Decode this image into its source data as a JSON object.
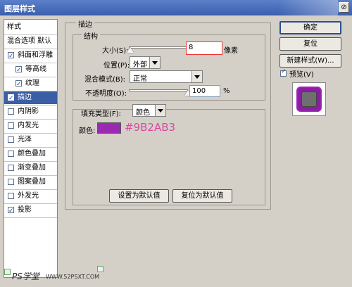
{
  "title": "图层样式",
  "window": {
    "close_label": "⊘"
  },
  "sidebar": {
    "header_styles": "样式",
    "header_blend": "混合选项 默认",
    "items": [
      {
        "label": "斜面和浮雕",
        "checked": true
      },
      {
        "label": "等高线",
        "checked": true
      },
      {
        "label": "纹理",
        "checked": true
      },
      {
        "label": "描边",
        "checked": true
      },
      {
        "label": "内阴影",
        "checked": false
      },
      {
        "label": "内发光",
        "checked": false
      },
      {
        "label": "光泽",
        "checked": false
      },
      {
        "label": "颜色叠加",
        "checked": false
      },
      {
        "label": "渐变叠加",
        "checked": false
      },
      {
        "label": "图案叠加",
        "checked": false
      },
      {
        "label": "外发光",
        "checked": false
      },
      {
        "label": "投影",
        "checked": true
      }
    ]
  },
  "stroke": {
    "section_title": "描边",
    "structure_title": "结构",
    "size_label": "大小(S):",
    "size_value": "8",
    "size_unit": "像素",
    "position_label": "位置(P):",
    "position_value": "外部",
    "blend_label": "混合模式(B):",
    "blend_value": "正常",
    "opacity_label": "不透明度(O):",
    "opacity_value": "100",
    "opacity_unit": "%",
    "fill_type_label": "填充类型(F):",
    "fill_type_value": "颜色",
    "color_label": "颜色:",
    "color_hex": "#9B2AB3",
    "color_swatch": "#9b2ab3",
    "size_slider_fraction": 0.03,
    "opacity_slider_fraction": 1.0
  },
  "buttons": {
    "ok": "确定",
    "reset": "复位",
    "new_style": "新建样式(W)...",
    "preview_label": "预览(V)",
    "set_default": "设置为默认值",
    "reset_default": "复位为默认值"
  },
  "watermark": {
    "left": "PS学堂",
    "right": "WWW.52PSXT.COM"
  }
}
